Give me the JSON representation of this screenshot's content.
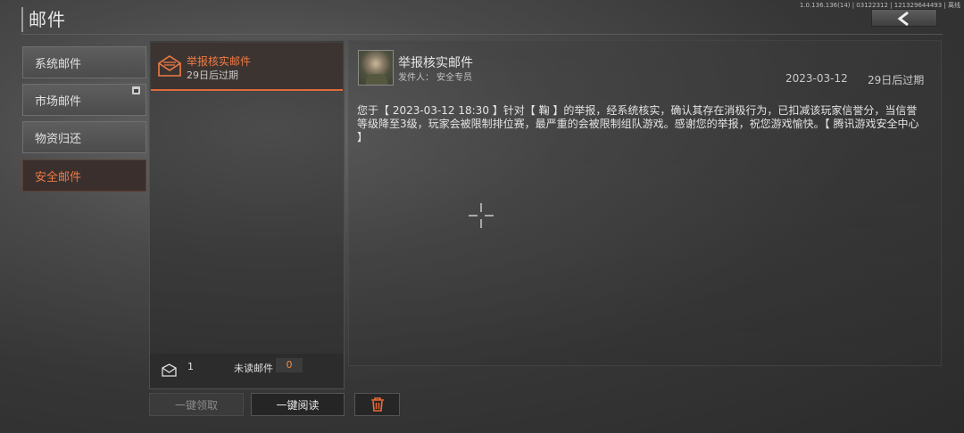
{
  "header": {
    "title": "邮件",
    "version": "1.0.136.136(14) | 03122312 | 121329644493 | 离线",
    "back_icon": "chevron-left-icon"
  },
  "categories": [
    {
      "label": "系统邮件",
      "active": false
    },
    {
      "label": "市场邮件",
      "active": false,
      "badge_icon": "gift-icon"
    },
    {
      "label": "物资归还",
      "active": false
    },
    {
      "label": "安全邮件",
      "active": true
    }
  ],
  "mail_list": {
    "items": [
      {
        "title": "举报核实邮件",
        "expire": "29日后过期",
        "icon": "envelope-icon"
      }
    ],
    "footer": {
      "count": "1",
      "unread_label": "未读邮件",
      "unread_count": "0"
    }
  },
  "detail": {
    "title": "举报核实邮件",
    "sender_label": "发件人：",
    "sender": "安全专员",
    "date": "2023-03-12",
    "expire": "29日后过期",
    "body": "您于【 2023-03-12 18:30 】针对【 鞠 】的举报，经系统核实，确认其存在消极行为，已扣减该玩家信誉分，当信誉等级降至3级，玩家会被限制排位赛，最严重的会被限制组队游戏。感谢您的举报，祝您游戏愉快。【 腾讯游戏安全中心 】"
  },
  "actions": {
    "claim_all": "一键领取",
    "read_all": "一键阅读",
    "delete_icon": "trash-icon"
  },
  "colors": {
    "accent": "#ee7a45",
    "active_bg": "#3a2f2d"
  }
}
